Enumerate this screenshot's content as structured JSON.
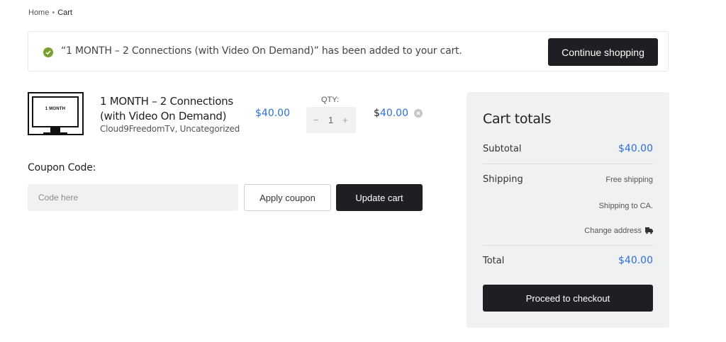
{
  "breadcrumb": {
    "home": "Home",
    "separator": "•",
    "current": "Cart"
  },
  "notice": {
    "message": "“1 MONTH – 2 Connections (with Video On Demand)” has been added to your cart.",
    "button": "Continue shopping",
    "icon": "check-circle-icon"
  },
  "cart_item": {
    "thumbnail_label": "1 MONTH",
    "title": "1 MONTH – 2 Connections (with Video On Demand)",
    "categories": "Cloud9FreedomTv, Uncategorized",
    "price": "$40.00",
    "qty_label": "QTY:",
    "qty_minus": "−",
    "qty_value": "1",
    "qty_plus": "+",
    "subtotal_currency": "$",
    "subtotal_amount": "40.00"
  },
  "coupon": {
    "label": "Coupon Code:",
    "placeholder": "Code here",
    "apply_label": "Apply coupon",
    "update_label": "Update cart"
  },
  "totals": {
    "heading": "Cart totals",
    "subtotal_label": "Subtotal",
    "subtotal_value": "$40.00",
    "shipping_label": "Shipping",
    "shipping_method": "Free shipping",
    "shipping_dest": "Shipping to CA.",
    "change_address": "Change address",
    "total_label": "Total",
    "total_value": "$40.00",
    "checkout_label": "Proceed to checkout"
  },
  "colors": {
    "accent": "#2b6fdc",
    "dark": "#1d1f22",
    "success": "#79a12e",
    "panel": "#f0f1f2"
  }
}
